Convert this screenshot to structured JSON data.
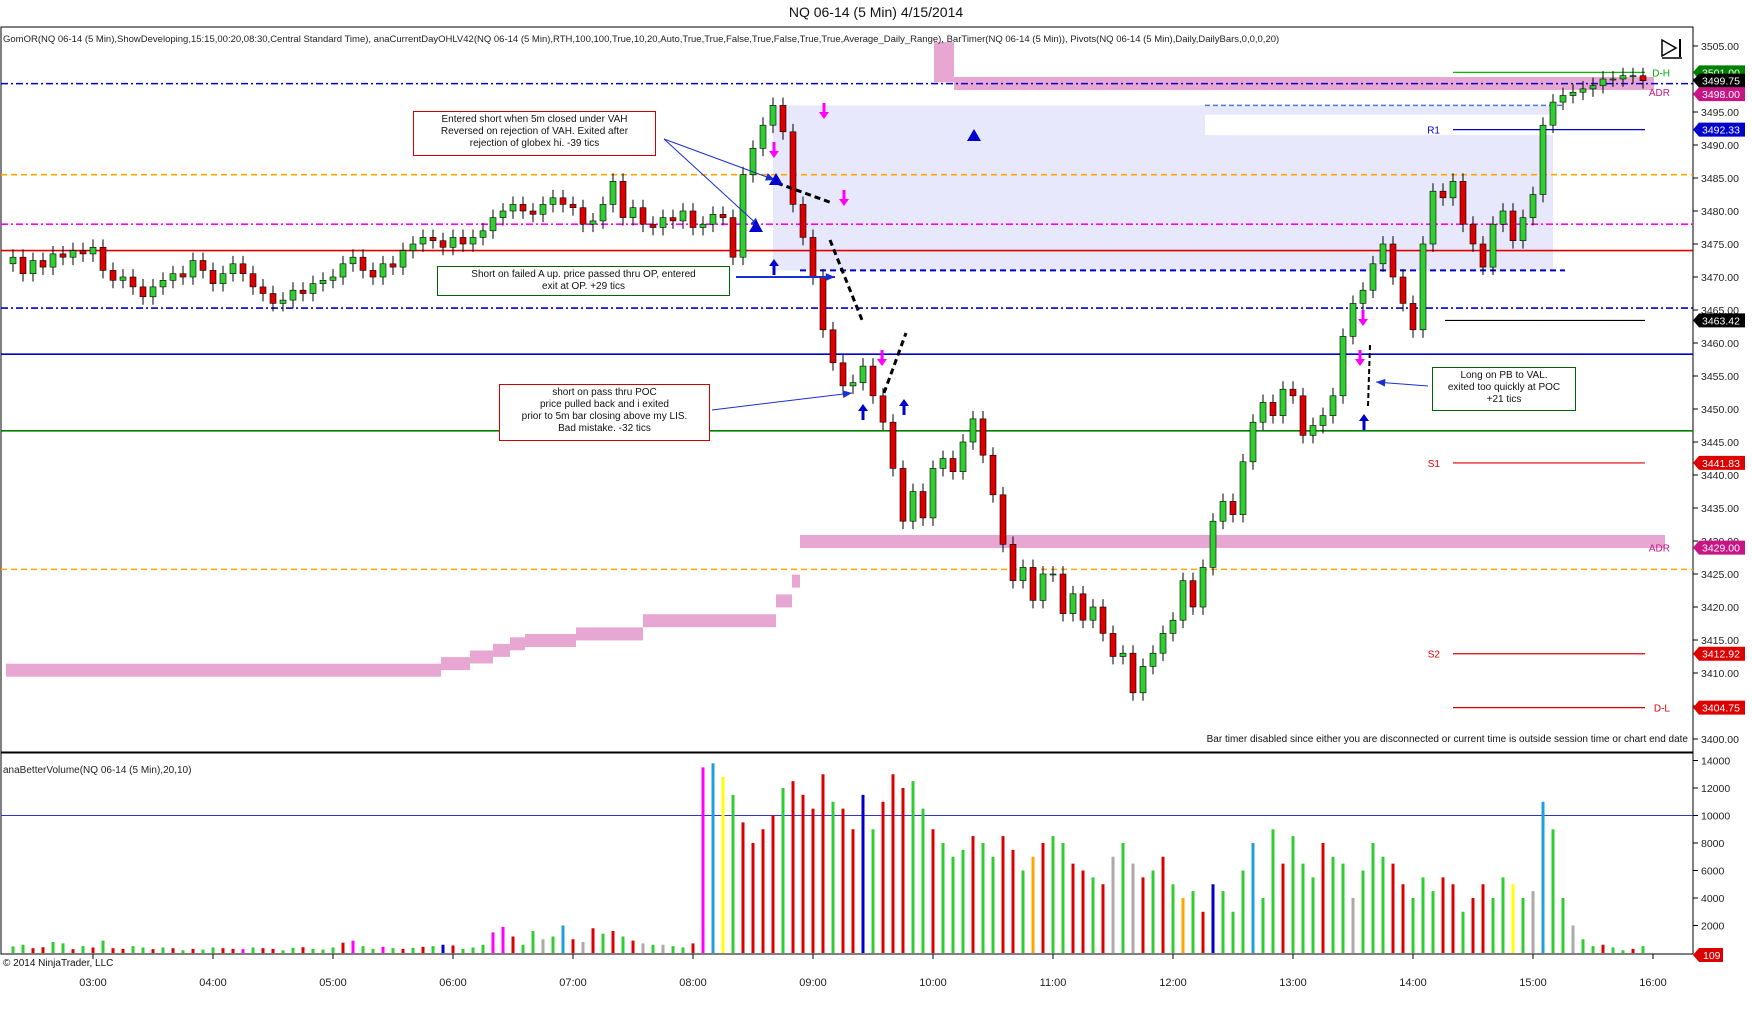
{
  "window": {
    "title": "NQ 06-14 (5 Min)  4/15/2014"
  },
  "indicators": {
    "price_line": "GomOR(NQ 06-14 (5 Min),ShowDeveloping,15:15,00:20,08:30,Central Standard Time), anaCurrentDayOHLV42(NQ 06-14 (5 Min),RTH,100,100,True,10,20,Auto,True,True,False,True,False,True,True,Average_Daily_Range), BarTimer(NQ 06-14 (5 Min)), Pivots(NQ 06-14 (5 Min),Daily,DailyBars,0,0,0,20)",
    "volume_line": "anaBetterVolume(NQ 06-14 (5 Min),20,10)"
  },
  "footer": {
    "copyright": "© 2014 NinjaTrader, LLC",
    "bar_timer_message": "Bar timer disabled since either you are disconnected or current time is outside session time or chart end date"
  },
  "annotations": {
    "note1": [
      "Entered short when 5m closed under VAH",
      "Reversed on rejection of VAH.  Exited after",
      "rejection of globex hi.  -39 tics"
    ],
    "note2": [
      "Short on failed A up.  price passed thru OP, entered",
      "exit at OP.  +29 tics"
    ],
    "note3": [
      "short on pass thru POC",
      "price pulled back and i exited",
      "prior to 5m bar closing above my LIS.",
      "Bad mistake.  -32 tics"
    ],
    "note4": [
      "Long on PB to VAL.",
      "exited too quickly at POC",
      "+21 tics"
    ]
  },
  "colors": {
    "up_candle": "#32cd32",
    "down_candle": "#dd0000",
    "profile": "#e8a6d2",
    "value_area": "#e3e4fa",
    "pivot_blue": "#0000cc",
    "red_line": "#dd0000",
    "green_line": "#008000",
    "orange_dash": "#ffa500",
    "magenta_dash": "#ff00ff"
  },
  "chart_data": [
    {
      "type": "candlestick",
      "title": "NQ 06-14 (5 Min)  4/15/2014",
      "x_axis": {
        "ticks": [
          "03:00",
          "04:00",
          "05:00",
          "06:00",
          "07:00",
          "08:00",
          "09:00",
          "10:00",
          "11:00",
          "12:00",
          "13:00",
          "14:00",
          "15:00",
          "16:00"
        ]
      },
      "y_axis": {
        "range": [
          3398,
          3507
        ],
        "ticks": [
          3400,
          3405,
          3410,
          3415,
          3420,
          3425,
          3430,
          3435,
          3440,
          3445,
          3450,
          3455,
          3460,
          3465,
          3470,
          3475,
          3480,
          3485,
          3490,
          3495,
          3500,
          3505
        ],
        "tick_labels": [
          "3400.00",
          "3405.00",
          "3410.00",
          "3415.00",
          "3420.00",
          "3425.00",
          "3430.00",
          "3435.00",
          "3440.00",
          "3445.00",
          "3450.00",
          "3455.00",
          "3460.00",
          "3465.00",
          "3470.00",
          "3475.00",
          "3480.00",
          "3485.00",
          "3490.00",
          "3495.00",
          "3500.00",
          "3505.00"
        ]
      },
      "price_labels": [
        {
          "text": "3501.00",
          "value": 3501.0,
          "color": "#008000"
        },
        {
          "text": "3499.75",
          "value": 3499.75,
          "color": "#000000"
        },
        {
          "text": "3498.00",
          "value": 3497.7,
          "color": "#c71585"
        },
        {
          "text": "3492.33",
          "value": 3492.33,
          "color": "#0000cc"
        },
        {
          "text": "3463.42",
          "value": 3463.42,
          "color": "#000000"
        },
        {
          "text": "3441.83",
          "value": 3441.83,
          "color": "#dd0000"
        },
        {
          "text": "3429.00",
          "value": 3429.0,
          "color": "#c71585"
        },
        {
          "text": "3412.92",
          "value": 3412.92,
          "color": "#dd0000"
        },
        {
          "text": "3404.75",
          "value": 3404.75,
          "color": "#dd0000"
        }
      ],
      "level_tags": [
        {
          "text": "D-H",
          "value": 3501.0,
          "color": "#00aa00"
        },
        {
          "text": "ADR",
          "value": 3498.0,
          "color": "#c71585"
        },
        {
          "text": "R1",
          "value": 3492.33,
          "color": "#0000cc"
        },
        {
          "text": "S1",
          "value": 3441.83,
          "color": "#dd0000"
        },
        {
          "text": "ADR",
          "value": 3429.0,
          "color": "#c71585"
        },
        {
          "text": "S2",
          "value": 3412.92,
          "color": "#dd0000"
        },
        {
          "text": "D-L",
          "value": 3404.75,
          "color": "#dd0000"
        }
      ],
      "closes": [
        3473,
        3470.5,
        3472.5,
        3471.5,
        3473.5,
        3473,
        3474,
        3473.5,
        3474.5,
        3471,
        3469.5,
        3470,
        3468.5,
        3467,
        3468.5,
        3469.5,
        3470.5,
        3470,
        3472.5,
        3471,
        3469,
        3470.5,
        3472,
        3470.5,
        3468.5,
        3467.5,
        3466,
        3466.5,
        3468,
        3467.5,
        3469,
        3469.5,
        3470,
        3472,
        3473,
        3471,
        3470,
        3472,
        3471.5,
        3474,
        3475,
        3476,
        3475.5,
        3474.5,
        3476,
        3475,
        3476,
        3477,
        3479,
        3480,
        3481,
        3480,
        3479.5,
        3481,
        3482,
        3481,
        3480.5,
        3478,
        3478.5,
        3481,
        3484.5,
        3479,
        3480.5,
        3478,
        3477.5,
        3479,
        3478.5,
        3480,
        3477.5,
        3478,
        3479.5,
        3479,
        3473,
        3485.5,
        3489.5,
        3493,
        3496,
        3492,
        3481,
        3476,
        3470,
        3462,
        3457,
        3453.5,
        3454,
        3456.5,
        3452,
        3448,
        3441,
        3433,
        3437.5,
        3433.5,
        3441,
        3442.5,
        3440.5,
        3445,
        3448.5,
        3443,
        3437,
        3429.5,
        3424,
        3426,
        3421,
        3425,
        3425,
        3419,
        3422,
        3418,
        3420,
        3416,
        3412.5,
        3413,
        3407,
        3411,
        3413,
        3416,
        3418,
        3424,
        3420,
        3426,
        3433,
        3436,
        3434,
        3442,
        3448,
        3451,
        3449,
        3453,
        3452,
        3446,
        3447.5,
        3449,
        3452,
        3461,
        3466,
        3468,
        3472,
        3475,
        3470,
        3466,
        3462,
        3475,
        3483,
        3482,
        3484.5,
        3478,
        3475,
        3471.5,
        3478,
        3480,
        3475.5,
        3479,
        3482.5,
        3493,
        3496.5,
        3497.5,
        3498,
        3498.5,
        3499,
        3500,
        3500,
        3500.5,
        3500.5,
        3499.75
      ],
      "value_area": {
        "high": 3496,
        "low": 3471,
        "x_start": "08:40",
        "x_end": "15:10"
      },
      "horizontal_levels": [
        {
          "value": 3499.3,
          "style": "dash-dot",
          "color": "#0000cc"
        },
        {
          "value": 3485.5,
          "style": "dashed",
          "color": "#ffa500"
        },
        {
          "value": 3478,
          "style": "dash-dot",
          "color": "#ff00ff"
        },
        {
          "value": 3474,
          "style": "solid",
          "color": "#dd0000"
        },
        {
          "value": 3465.3,
          "style": "dash-dot",
          "color": "#0000cc"
        },
        {
          "value": 3458.3,
          "style": "solid",
          "color": "#0000cc"
        },
        {
          "value": 3446.7,
          "style": "solid",
          "color": "#008000"
        },
        {
          "value": 3425.7,
          "style": "dashed",
          "color": "#ffa500"
        }
      ]
    },
    {
      "type": "bar",
      "title": "anaBetterVolume(NQ 06-14 (5 Min),20,10)",
      "y_axis": {
        "range": [
          0,
          14500
        ],
        "ticks": [
          2000,
          4000,
          6000,
          8000,
          10000,
          12000,
          14000
        ],
        "tick_labels": [
          "2000",
          "4000",
          "6000",
          "8000",
          "10000",
          "12000",
          "14000"
        ]
      },
      "reference_line": 10000,
      "last_value_label": "109",
      "values": [
        480,
        600,
        350,
        420,
        800,
        700,
        280,
        500,
        400,
        900,
        350,
        300,
        500,
        400,
        280,
        400,
        350,
        200,
        300,
        250,
        400,
        350,
        300,
        280,
        400,
        350,
        300,
        200,
        380,
        420,
        300,
        250,
        400,
        750,
        900,
        500,
        300,
        450,
        350,
        300,
        380,
        450,
        500,
        600,
        550,
        300,
        400,
        600,
        1500,
        1900,
        1200,
        600,
        1600,
        1000,
        1200,
        2000,
        1000,
        800,
        1800,
        1400,
        1600,
        1200,
        900,
        700,
        600,
        600,
        500,
        400,
        700,
        13500,
        13800,
        12800,
        11500,
        9500,
        8000,
        9000,
        10000,
        12000,
        12500,
        11500,
        10500,
        13000,
        11000,
        10500,
        9000,
        11500,
        9000,
        11000,
        13000,
        12000,
        12500,
        10500,
        9000,
        8000,
        7000,
        7500,
        8500,
        8000,
        7000,
        8500,
        7500,
        6000,
        7000,
        8000,
        8500,
        8000,
        6500,
        6000,
        5500,
        5000,
        7000,
        8000,
        6500,
        5500,
        6000,
        7000,
        5000,
        4000,
        4500,
        3000,
        5000,
        4500,
        3000,
        6000,
        8000,
        4000,
        9000,
        6500,
        8500,
        6500,
        5500,
        8000,
        7000,
        6500,
        4000,
        6000,
        8000,
        7000,
        6500,
        5000,
        4000,
        5500,
        4500,
        5500,
        5000,
        3000,
        4000,
        5000,
        4000,
        5500,
        5000,
        4000,
        4500,
        11000,
        9000,
        4000,
        2000,
        1000,
        500,
        600,
        400,
        200,
        300,
        500
      ],
      "colors": [
        "#32cd32",
        "#32cd32",
        "#dd0000",
        "#dd0000",
        "#32cd32",
        "#32cd32",
        "#dd0000",
        "#32cd32",
        "#dd0000",
        "#32cd32",
        "#dd0000",
        "#dd0000",
        "#32cd32",
        "#32cd32",
        "#dd0000",
        "#32cd32",
        "#dd0000",
        "#32cd32",
        "#dd0000",
        "#32cd32",
        "#32cd32",
        "#dd0000",
        "#dd0000",
        "#ff00ff",
        "#32cd32",
        "#dd0000",
        "#dd0000",
        "#32cd32",
        "#32cd32",
        "#dd0000",
        "#32cd32",
        "#32cd32",
        "#32cd32",
        "#dd0000",
        "#ff00ff",
        "#32cd32",
        "#32cd32",
        "#ff00ff",
        "#32cd32",
        "#dd0000",
        "#32cd32",
        "#dd0000",
        "#32cd32",
        "#0000cc",
        "#dd0000",
        "#32cd32",
        "#32cd32",
        "#32cd32",
        "#ff00ff",
        "#ff00ff",
        "#dd0000",
        "#32cd32",
        "#32cd32",
        "#aaaaaa",
        "#32cd32",
        "#1ea0dc",
        "#dd0000",
        "#aaaaaa",
        "#dd0000",
        "#32cd32",
        "#dd0000",
        "#32cd32",
        "#dd0000",
        "#aaaaaa",
        "#32cd32",
        "#aaaaaa",
        "#32cd32",
        "#32cd32",
        "#dd0000",
        "#ff00ff",
        "#1ea0dc",
        "#ffff00",
        "#32cd32",
        "#dd0000",
        "#dd0000",
        "#dd0000",
        "#dd0000",
        "#32cd32",
        "#dd0000",
        "#dd0000",
        "#dd0000",
        "#dd0000",
        "#32cd32",
        "#dd0000",
        "#dd0000",
        "#0000cc",
        "#32cd32",
        "#dd0000",
        "#dd0000",
        "#dd0000",
        "#32cd32",
        "#32cd32",
        "#dd0000",
        "#32cd32",
        "#32cd32",
        "#32cd32",
        "#dd0000",
        "#32cd32",
        "#32cd32",
        "#dd0000",
        "#dd0000",
        "#32cd32",
        "#ffa500",
        "#dd0000",
        "#32cd32",
        "#32cd32",
        "#dd0000",
        "#dd0000",
        "#32cd32",
        "#dd0000",
        "#aaaaaa",
        "#32cd32",
        "#aaaaaa",
        "#dd0000",
        "#32cd32",
        "#dd0000",
        "#32cd32",
        "#ffa500",
        "#32cd32",
        "#dd0000",
        "#0000cc",
        "#32cd32",
        "#32cd32",
        "#32cd32",
        "#1ea0dc",
        "#32cd32",
        "#32cd32",
        "#dd0000",
        "#32cd32",
        "#32cd32",
        "#32cd32",
        "#dd0000",
        "#32cd32",
        "#32cd32",
        "#aaaaaa",
        "#32cd32",
        "#32cd32",
        "#32cd32",
        "#dd0000",
        "#dd0000",
        "#32cd32",
        "#32cd32",
        "#32cd32",
        "#dd0000",
        "#dd0000",
        "#32cd32",
        "#dd0000",
        "#dd0000",
        "#32cd32",
        "#32cd32",
        "#ffff00",
        "#32cd32",
        "#aaaaaa",
        "#1ea0dc",
        "#32cd32",
        "#32cd32",
        "#aaaaaa",
        "#32cd32",
        "#32cd32",
        "#dd0000",
        "#32cd32",
        "#32cd32",
        "#dd0000",
        "#32cd32",
        "#32cd32"
      ]
    }
  ]
}
